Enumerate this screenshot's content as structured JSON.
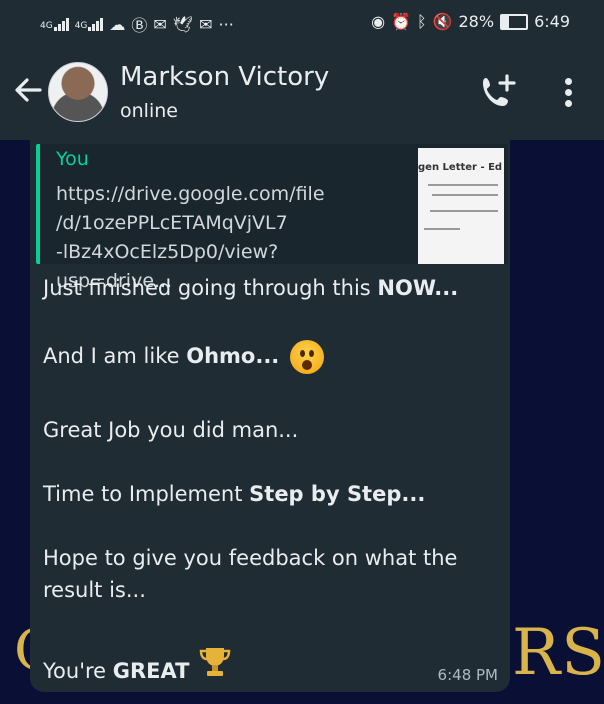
{
  "statusbar": {
    "net1": "4G",
    "net2": "4G",
    "battery": "28%",
    "battery_level": 0.28,
    "time": "6:49",
    "overflow": "···"
  },
  "header": {
    "contact_name": "Markson Victory",
    "presence": "online",
    "icons": [
      "back-arrow-icon",
      "add-call-icon",
      "overflow-menu-icon"
    ]
  },
  "wallpaper": {
    "left_text": "C",
    "right_text": "RS"
  },
  "message": {
    "quoted": {
      "author": "You",
      "link": "https://drive.google.com/file\n/d/1ozePPLcETAMqVjVL7\n-lBz4xOcElz5Dp0/view?usp=drive...",
      "thumbnail_title": "gen Letter - Ed"
    },
    "line1_prefix": "Just finished going through this ",
    "line1_bold": "NOW...",
    "line2_prefix": "And I am like ",
    "line2_bold": "Ohmo...",
    "line3": "Great Job you did man...",
    "line4_prefix": "Time to Implement ",
    "line4_bold": "Step by Step...",
    "line5a": "Hope to give you feedback on what the",
    "line5b": "result is...",
    "line6_prefix": "You're ",
    "line6_bold": "GREAT",
    "time": "6:48 PM"
  },
  "colors": {
    "accent": "#06cf9c",
    "bubble": "#1f2c33",
    "wallpaper": "#0a0f36",
    "gold": "#d9b44a"
  }
}
